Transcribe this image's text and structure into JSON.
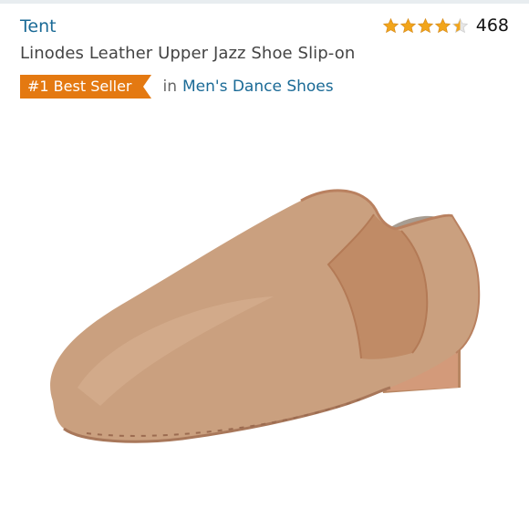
{
  "header": {
    "brand": "Tent",
    "rating": {
      "stars": 4.5,
      "max_stars": 5,
      "count": "468"
    }
  },
  "product": {
    "title": "Linodes Leather Upper Jazz Shoe Slip-on",
    "badge": "#1 Best Seller",
    "category_prefix": "in",
    "category": "Men's Dance Shoes"
  },
  "colors": {
    "link": "#1a6a96",
    "badge": "#e47911",
    "star": "#f2a51a",
    "shoe": "#c99a77"
  },
  "icons": {
    "star_filled": "star-icon",
    "star_half": "star-half-icon"
  }
}
